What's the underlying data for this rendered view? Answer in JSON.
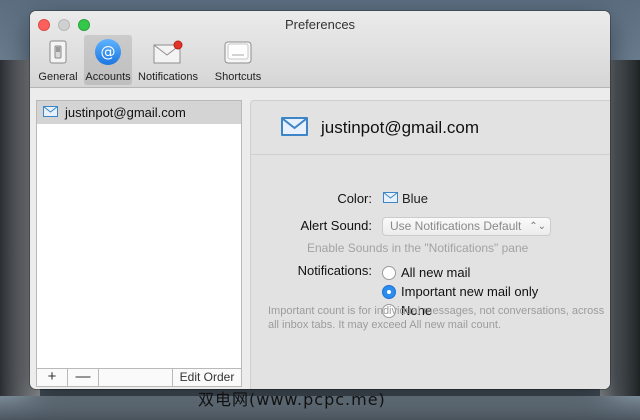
{
  "window": {
    "title": "Preferences"
  },
  "toolbar": {
    "items": [
      {
        "label": "General",
        "icon": "general-switch-icon"
      },
      {
        "label": "Accounts",
        "icon": "at-sign-icon",
        "selected": true
      },
      {
        "label": "Notifications",
        "icon": "notification-envelope-icon"
      },
      {
        "label": "Shortcuts",
        "icon": "keyboard-key-icon"
      }
    ]
  },
  "accounts": {
    "items": [
      {
        "label": "justinpot@gmail.com",
        "icon": "envelope-icon"
      }
    ],
    "footer": {
      "add": "+",
      "remove": "—",
      "edit_order": "Edit Order"
    }
  },
  "detail": {
    "email": "justinpot@gmail.com",
    "color_label": "Color:",
    "color_value": "Blue",
    "color_hex": "#3d85c6",
    "alert_label": "Alert Sound:",
    "alert_value": "Use Notifications Default",
    "alert_hint": "Enable Sounds in the \"Notifications\" pane",
    "notifications_label": "Notifications:",
    "notification_options": [
      {
        "label": "All new mail",
        "checked": false
      },
      {
        "label": "Important new mail only",
        "checked": true
      },
      {
        "label": "None",
        "checked": false
      }
    ],
    "note": "Important count is for individual messages, not conversations, across all inbox tabs. It may exceed All new mail count."
  },
  "watermark": "双电网(www.pcpc.me)"
}
